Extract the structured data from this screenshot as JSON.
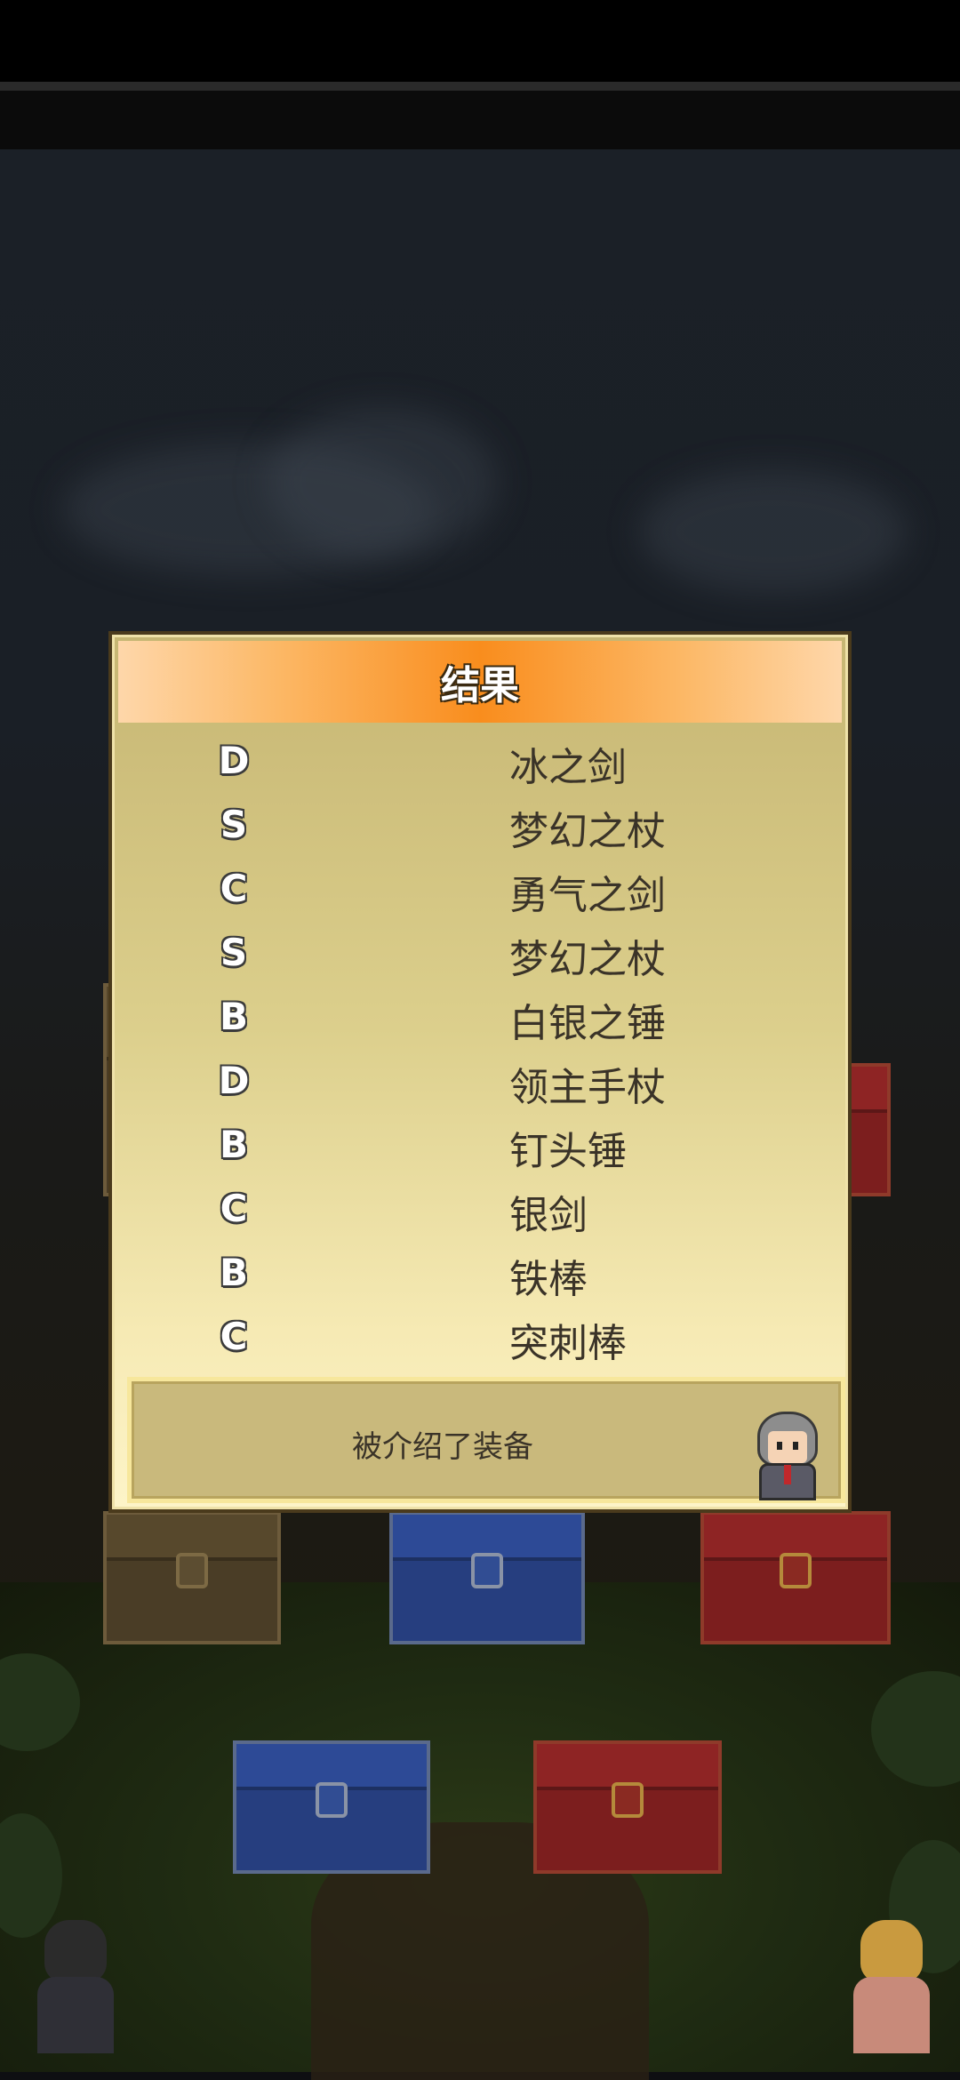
{
  "dialog": {
    "title": "结果",
    "results": [
      {
        "rank": "D",
        "item": "冰之剑"
      },
      {
        "rank": "S",
        "item": "梦幻之杖"
      },
      {
        "rank": "C",
        "item": "勇气之剑"
      },
      {
        "rank": "S",
        "item": "梦幻之杖"
      },
      {
        "rank": "B",
        "item": "白银之锤"
      },
      {
        "rank": "D",
        "item": "领主手杖"
      },
      {
        "rank": "B",
        "item": "钉头锤"
      },
      {
        "rank": "C",
        "item": "银剑"
      },
      {
        "rank": "B",
        "item": "铁棒"
      },
      {
        "rank": "C",
        "item": "突刺棒"
      }
    ],
    "message": "被介绍了装备"
  },
  "scene": {
    "chests": [
      "brown",
      "blue",
      "red",
      "blue",
      "red"
    ],
    "colors": {
      "header_orange": "#f98d1d",
      "panel_gold": "#dccf8c",
      "text_dark": "#3a3328"
    }
  }
}
